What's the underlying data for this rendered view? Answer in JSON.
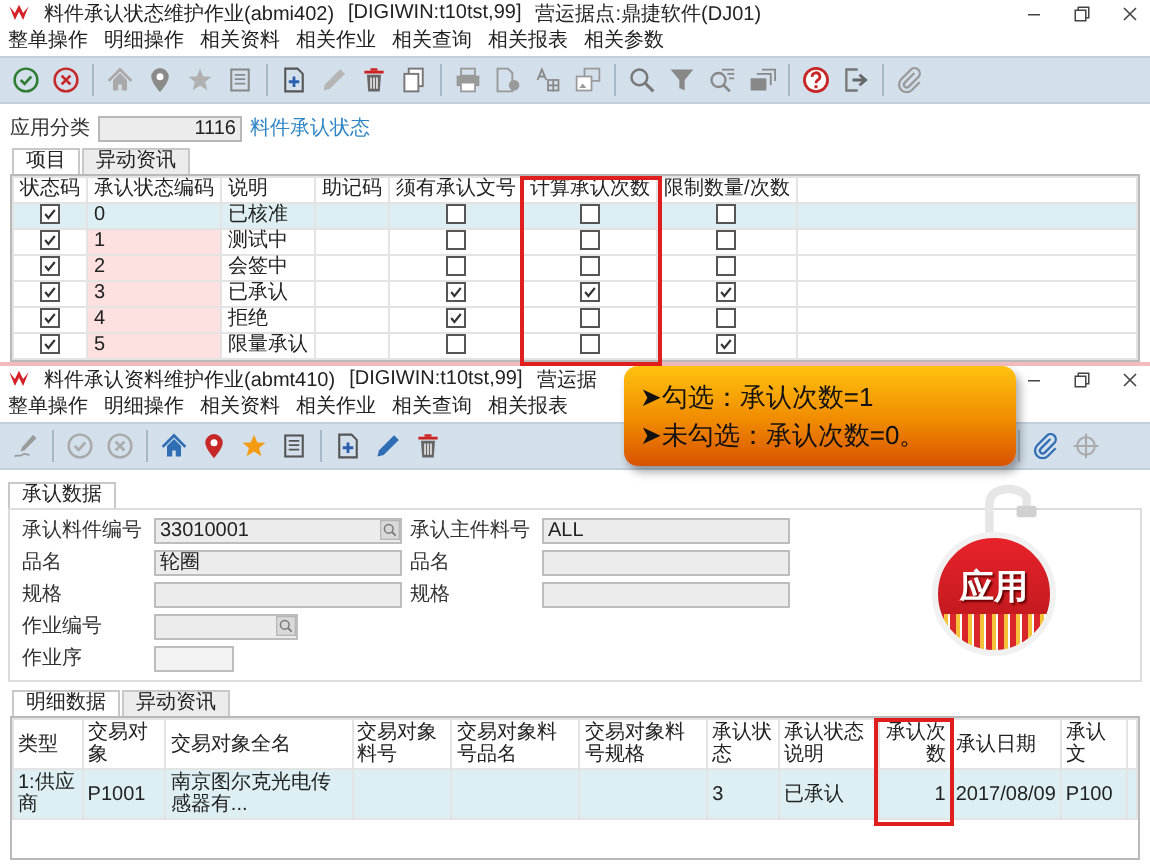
{
  "top_window": {
    "title": "料件承认状态维护作业(abmi402)",
    "environment": "[DIGIWIN:t10tst,99]",
    "site": "营运据点:鼎捷软件(DJ01)",
    "menu": [
      "整单操作",
      "明细操作",
      "相关资料",
      "相关作业",
      "相关查询",
      "相关报表",
      "相关参数"
    ],
    "category": {
      "label": "应用分类",
      "value": "1116",
      "description": "料件承认状态"
    },
    "tabs": [
      {
        "label": "项目",
        "selected": true
      },
      {
        "label": "异动资讯",
        "selected": false
      }
    ],
    "table": {
      "columns": [
        {
          "label": "状态码",
          "kind": "check",
          "highlighted": false
        },
        {
          "label": "承认状态编码",
          "kind": "code",
          "highlighted": false
        },
        {
          "label": "说明",
          "kind": "text",
          "highlighted": false
        },
        {
          "label": "助记码",
          "kind": "text",
          "highlighted": false
        },
        {
          "label": "须有承认文号",
          "kind": "check",
          "highlighted": false
        },
        {
          "label": "计算承认次数",
          "kind": "check",
          "highlighted": true
        },
        {
          "label": "限制数量/次数",
          "kind": "check",
          "highlighted": false
        }
      ],
      "rows": [
        {
          "selected": true,
          "cells": [
            true,
            "0",
            "已核准",
            null,
            false,
            false,
            false
          ]
        },
        {
          "selected": false,
          "cells": [
            true,
            "1",
            "测试中",
            null,
            false,
            false,
            false
          ]
        },
        {
          "selected": false,
          "cells": [
            true,
            "2",
            "会签中",
            null,
            false,
            false,
            false
          ]
        },
        {
          "selected": false,
          "cells": [
            true,
            "3",
            "已承认",
            null,
            true,
            true,
            true
          ]
        },
        {
          "selected": false,
          "cells": [
            true,
            "4",
            "拒绝",
            null,
            true,
            false,
            false
          ]
        },
        {
          "selected": false,
          "cells": [
            true,
            "5",
            "限量承认",
            null,
            false,
            false,
            true
          ]
        }
      ]
    }
  },
  "bottom_window": {
    "title": "料件承认资料维护作业(abmt410)",
    "environment": "[DIGIWIN:t10tst,99]",
    "site": "营运据",
    "menu": [
      "整单操作",
      "明细操作",
      "相关资料",
      "相关作业",
      "相关查询",
      "相关报表"
    ],
    "tabs": [
      {
        "label": "承认数据",
        "selected": true
      }
    ],
    "form": [
      [
        {
          "label": "承认料件编号",
          "value": "33010001",
          "lookup": true,
          "kind": "long"
        },
        {
          "label": "承认主件料号",
          "value": "ALL",
          "lookup": false,
          "kind": "long"
        }
      ],
      [
        {
          "label": "品名",
          "value": "轮圈",
          "lookup": false,
          "kind": "long"
        },
        {
          "label": "品名",
          "lookup": false,
          "kind": "long"
        }
      ],
      [
        {
          "label": "规格",
          "lookup": false,
          "kind": "long"
        },
        {
          "label": "规格",
          "lookup": false,
          "kind": "long"
        }
      ],
      [
        {
          "label": "作业编号",
          "lookup": true,
          "kind": "short"
        }
      ],
      [
        {
          "label": "作业序",
          "lookup": false,
          "kind": "tiny"
        }
      ]
    ],
    "detail_tabs": [
      {
        "label": "明细数据",
        "selected": true
      },
      {
        "label": "异动资讯",
        "selected": false
      }
    ],
    "detail_table": {
      "columns": [
        {
          "label": "类型",
          "kind": "text",
          "highlighted": false
        },
        {
          "label": "交易对象",
          "kind": "text",
          "highlighted": false
        },
        {
          "label": "交易对象全名",
          "kind": "text",
          "highlighted": false
        },
        {
          "label": "交易对象料号",
          "kind": "text",
          "highlighted": false
        },
        {
          "label": "交易对象料号品名",
          "kind": "text",
          "highlighted": false
        },
        {
          "label": "交易对象料号规格",
          "kind": "text",
          "highlighted": false
        },
        {
          "label": "承认状态",
          "kind": "text",
          "highlighted": false
        },
        {
          "label": "承认状态说明",
          "kind": "text",
          "highlighted": false
        },
        {
          "label": "承认次数",
          "kind": "number",
          "highlighted": true
        },
        {
          "label": "承认日期",
          "kind": "text",
          "highlighted": false
        },
        {
          "label": "承认文",
          "kind": "text",
          "highlighted": false
        }
      ],
      "rows": [
        {
          "selected": true,
          "cells": [
            "1:供应商",
            "P1001",
            "南京图尔克光电传感器有...",
            null,
            null,
            null,
            "3",
            "已承认",
            "1",
            "2017/08/09",
            "P100"
          ]
        }
      ]
    }
  },
  "callout": {
    "lines": [
      "➤勾选：承认次数=1",
      "➤未勾选：承认次数=0。"
    ]
  },
  "tag": {
    "label": "应用"
  }
}
